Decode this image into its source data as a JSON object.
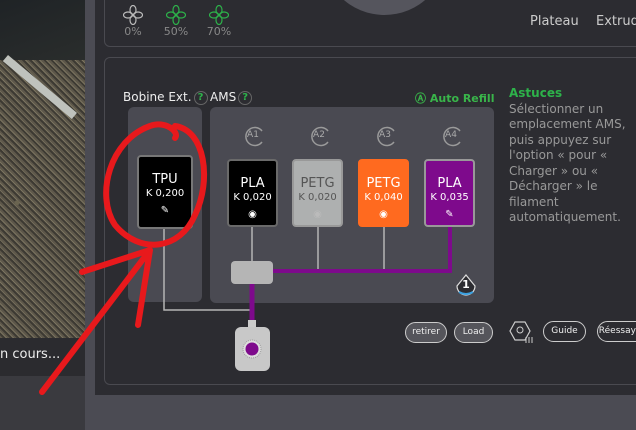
{
  "camera": {
    "status_text": "n cours..."
  },
  "fans": [
    {
      "value": "0%",
      "active": false
    },
    {
      "value": "50%",
      "active": true
    },
    {
      "value": "70%",
      "active": true
    }
  ],
  "top_nav": {
    "plate": "Plateau",
    "extruder": "Extrud"
  },
  "filament": {
    "external": {
      "label": "Bobine Ext.",
      "help": "?",
      "spool": {
        "material": "TPU",
        "k": "K 0,200",
        "color": "#000000",
        "icon": "edit-icon"
      }
    },
    "ams": {
      "label": "AMS",
      "help": "?",
      "auto_refill": "Auto Refill",
      "unit_badge": "1",
      "slots": [
        {
          "id": "A1",
          "material": "PLA",
          "k": "K 0,020",
          "color": "#000000",
          "text_color": "#ffffff",
          "icon": "eye-icon"
        },
        {
          "id": "A2",
          "material": "PETG",
          "k": "K 0,020",
          "color": "#aeb0b0",
          "text_color": "#555555",
          "icon": "eye-icon"
        },
        {
          "id": "A3",
          "material": "PETG",
          "k": "K 0,040",
          "color": "#ff6a1f",
          "text_color": "#ffffff",
          "icon": "eye-icon"
        },
        {
          "id": "A4",
          "material": "PLA",
          "k": "K 0,035",
          "color": "#7e0a8c",
          "text_color": "#ffffff",
          "icon": "edit-icon"
        }
      ],
      "active_color": "#7e0a8c"
    }
  },
  "tips": {
    "title": "Astuces",
    "text": "Sélectionner un emplacement AMS, puis appuyez sur l'option « pour « Charger » ou « Décharger » le filament automatiquement."
  },
  "actions": {
    "unload": "retirer",
    "load": "Load",
    "guide": "Guide",
    "retry": "Réessayer"
  },
  "annotation": {
    "color": "#e8191c"
  }
}
